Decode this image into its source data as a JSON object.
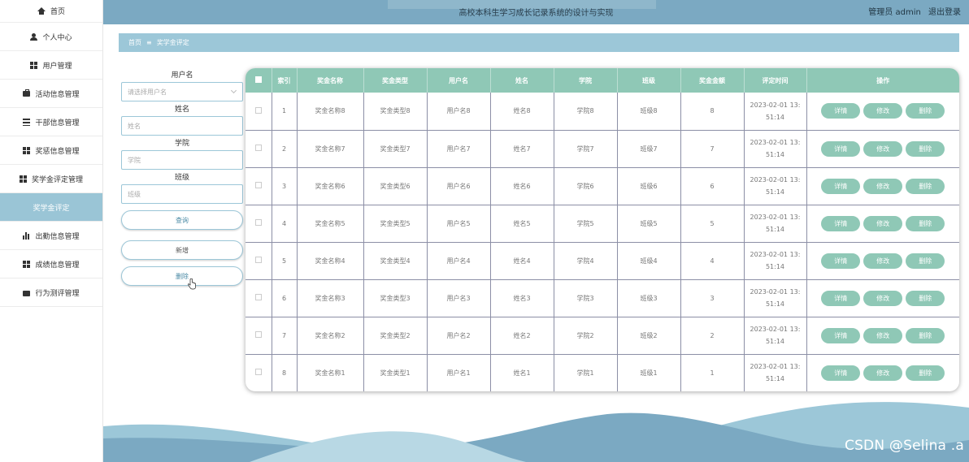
{
  "header": {
    "title": "高校本科生学习成长记录系统的设计与实现",
    "user_label": "管理员 admin",
    "logout": "退出登录"
  },
  "sidebar": {
    "items": [
      {
        "label": "首页",
        "icon": "home-icon"
      },
      {
        "label": "个人中心",
        "icon": "user-icon"
      },
      {
        "label": "用户管理",
        "icon": "grid-icon"
      },
      {
        "label": "活动信息管理",
        "icon": "briefcase-icon"
      },
      {
        "label": "干部信息管理",
        "icon": "list-icon"
      },
      {
        "label": "奖惩信息管理",
        "icon": "grid-icon"
      },
      {
        "label": "奖学金评定管理",
        "icon": "grid-icon"
      },
      {
        "label": "奖学金评定",
        "icon": "",
        "active": true
      },
      {
        "label": "出勤信息管理",
        "icon": "bar-chart-icon"
      },
      {
        "label": "成绩信息管理",
        "icon": "grid-icon"
      },
      {
        "label": "行为测评管理",
        "icon": "wallet-icon"
      }
    ]
  },
  "breadcrumb": {
    "home": "首页",
    "separator": "≡",
    "current": "奖学金评定"
  },
  "search": {
    "username_label": "用户名",
    "username_placeholder": "请选择用户名",
    "name_label": "姓名",
    "name_placeholder": "姓名",
    "college_label": "学院",
    "college_placeholder": "学院",
    "class_label": "班级",
    "class_placeholder": "班级",
    "query_button": "查询",
    "add_button": "新增",
    "delete_button": "删除"
  },
  "table": {
    "columns": [
      "索引",
      "奖金名称",
      "奖金类型",
      "用户名",
      "姓名",
      "学院",
      "班级",
      "奖金金额",
      "评定时间",
      "操作"
    ],
    "actions": {
      "detail": "详情",
      "edit": "修改",
      "delete": "删除"
    },
    "rows": [
      {
        "index": "1",
        "award_name": "奖金名称8",
        "award_type": "奖金类型8",
        "username": "用户名8",
        "name": "姓名8",
        "college": "学院8",
        "class": "班级8",
        "amount": "8",
        "time1": "2023-02-01 13:",
        "time2": "51:14"
      },
      {
        "index": "2",
        "award_name": "奖金名称7",
        "award_type": "奖金类型7",
        "username": "用户名7",
        "name": "姓名7",
        "college": "学院7",
        "class": "班级7",
        "amount": "7",
        "time1": "2023-02-01 13:",
        "time2": "51:14"
      },
      {
        "index": "3",
        "award_name": "奖金名称6",
        "award_type": "奖金类型6",
        "username": "用户名6",
        "name": "姓名6",
        "college": "学院6",
        "class": "班级6",
        "amount": "6",
        "time1": "2023-02-01 13:",
        "time2": "51:14"
      },
      {
        "index": "4",
        "award_name": "奖金名称5",
        "award_type": "奖金类型5",
        "username": "用户名5",
        "name": "姓名5",
        "college": "学院5",
        "class": "班级5",
        "amount": "5",
        "time1": "2023-02-01 13:",
        "time2": "51:14"
      },
      {
        "index": "5",
        "award_name": "奖金名称4",
        "award_type": "奖金类型4",
        "username": "用户名4",
        "name": "姓名4",
        "college": "学院4",
        "class": "班级4",
        "amount": "4",
        "time1": "2023-02-01 13:",
        "time2": "51:14"
      },
      {
        "index": "6",
        "award_name": "奖金名称3",
        "award_type": "奖金类型3",
        "username": "用户名3",
        "name": "姓名3",
        "college": "学院3",
        "class": "班级3",
        "amount": "3",
        "time1": "2023-02-01 13:",
        "time2": "51:14"
      },
      {
        "index": "7",
        "award_name": "奖金名称2",
        "award_type": "奖金类型2",
        "username": "用户名2",
        "name": "姓名2",
        "college": "学院2",
        "class": "班级2",
        "amount": "2",
        "time1": "2023-02-01 13:",
        "time2": "51:14"
      },
      {
        "index": "8",
        "award_name": "奖金名称1",
        "award_type": "奖金类型1",
        "username": "用户名1",
        "name": "姓名1",
        "college": "学院1",
        "class": "班级1",
        "amount": "1",
        "time1": "2023-02-01 13:",
        "time2": "51:14"
      }
    ]
  },
  "watermark": "CSDN @Selina .a",
  "colors": {
    "header": "#7ba9c2",
    "accent": "#9cc7d8",
    "table_header": "#8fc8b6",
    "action_button": "#8fc8b6"
  }
}
